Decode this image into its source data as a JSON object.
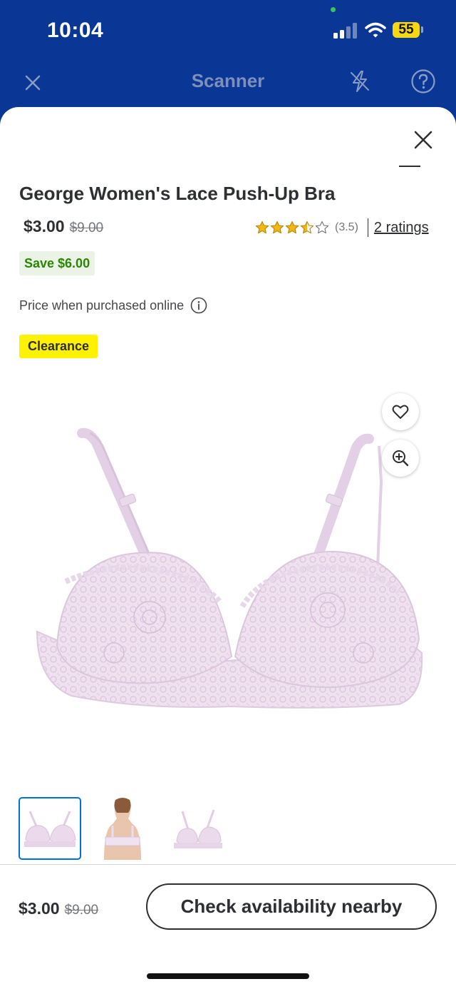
{
  "status_bar": {
    "time": "10:04",
    "battery": "55"
  },
  "scanner_header": {
    "title": "Scanner"
  },
  "product": {
    "title": "George Women's Lace Push-Up Bra",
    "price": "$3.00",
    "was_price": "$9.00",
    "rating": 3.5,
    "rating_label": "(3.5)",
    "ratings_link": "2 ratings",
    "save_badge": "Save $6.00",
    "online_note": "Price when purchased online",
    "clearance_badge": "Clearance",
    "image_color": "#ecdcec"
  },
  "gallery": {
    "thumbnail_count": 3,
    "selected_index": 0
  },
  "bottom_bar": {
    "price": "$3.00",
    "was_price": "$9.00",
    "cta_label": "Check availability nearby"
  },
  "colors": {
    "header_blue": "#0a3696",
    "star_gold": "#f0b812",
    "save_green": "#2a8703",
    "clearance_yellow": "#fff200",
    "selected_blue": "#0071dc"
  },
  "icons": [
    "close-icon",
    "flash-off-icon",
    "help-icon",
    "heart-icon",
    "zoom-in-icon",
    "info-icon",
    "star-icon"
  ]
}
